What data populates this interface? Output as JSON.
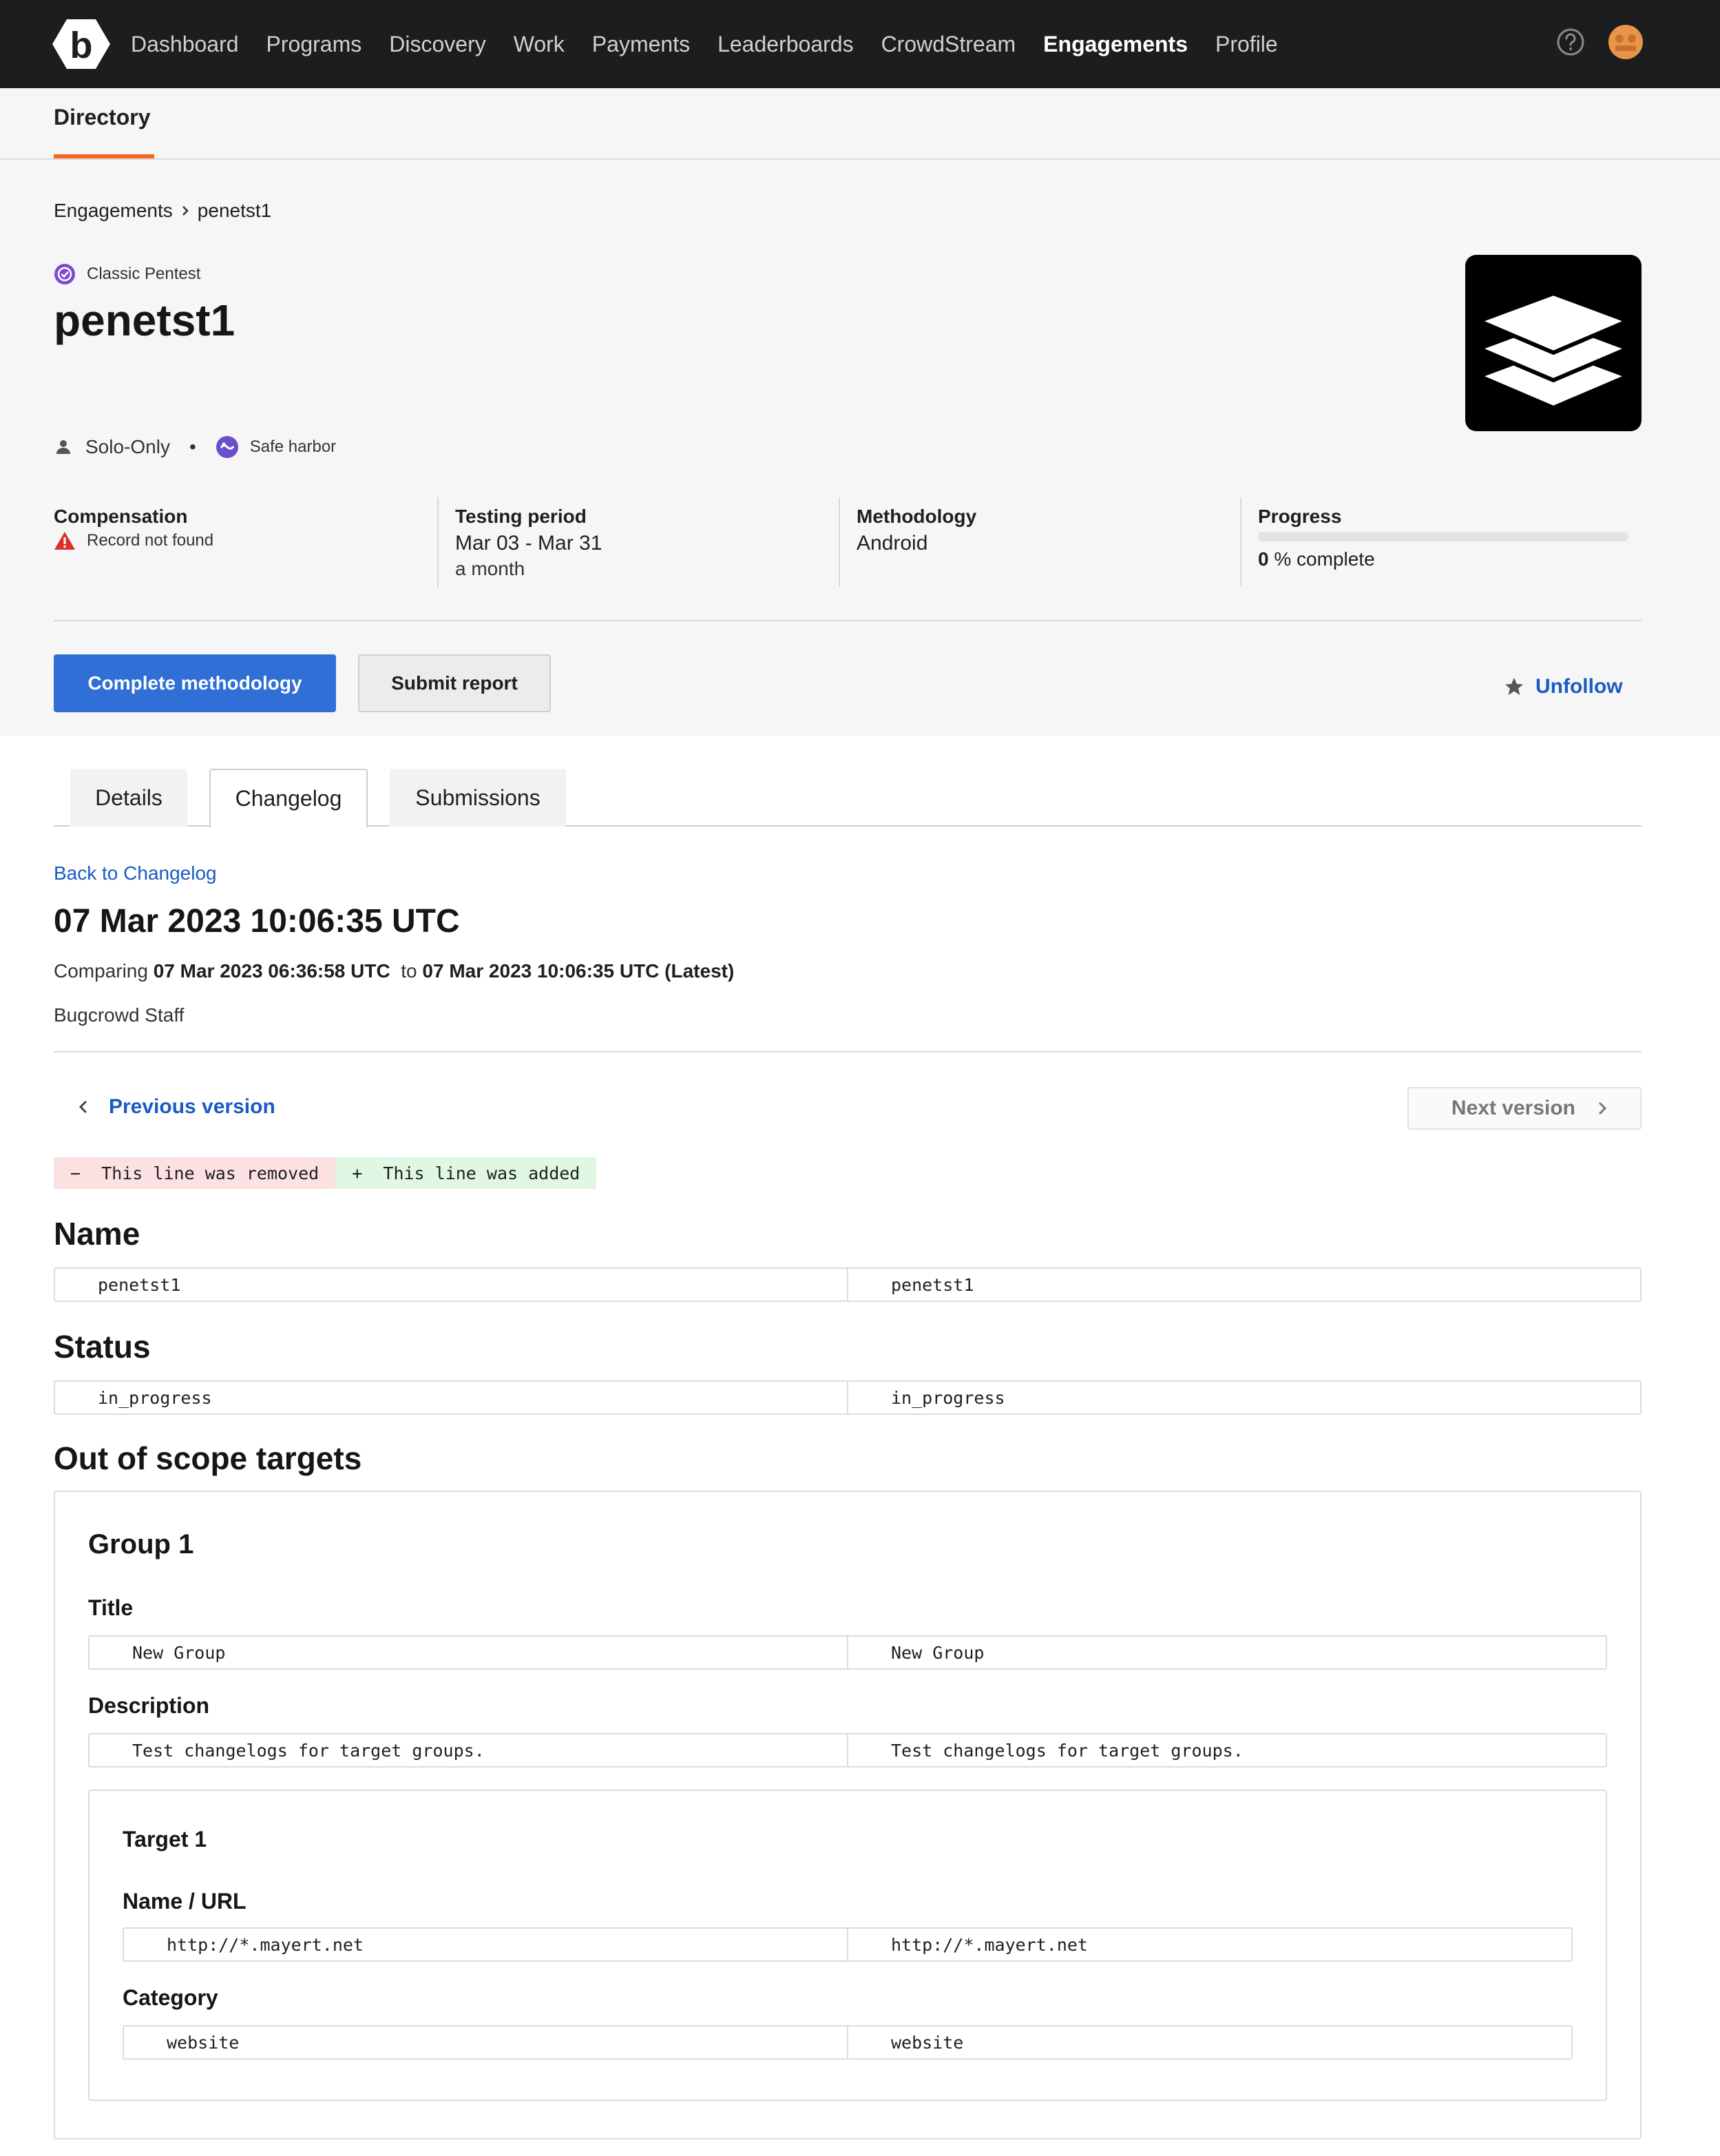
{
  "nav": {
    "items": [
      {
        "label": "Dashboard",
        "active": false
      },
      {
        "label": "Programs",
        "active": false
      },
      {
        "label": "Discovery",
        "active": false
      },
      {
        "label": "Work",
        "active": false
      },
      {
        "label": "Payments",
        "active": false
      },
      {
        "label": "Leaderboards",
        "active": false
      },
      {
        "label": "CrowdStream",
        "active": false
      },
      {
        "label": "Engagements",
        "active": true
      },
      {
        "label": "Profile",
        "active": false
      }
    ]
  },
  "subheader": {
    "tab": "Directory"
  },
  "breadcrumb": {
    "parent": "Engagements",
    "current": "penetst1"
  },
  "engagement": {
    "type": "Classic Pentest",
    "title": "penetst1",
    "mode": "Solo-Only",
    "safe_harbor": "Safe harbor"
  },
  "stats": {
    "compensation": {
      "label": "Compensation",
      "value": "Record not found"
    },
    "testing_period": {
      "label": "Testing period",
      "value": "Mar 03 - Mar 31",
      "sub": "a month"
    },
    "methodology": {
      "label": "Methodology",
      "value": "Android"
    },
    "progress": {
      "label": "Progress",
      "percent": "0",
      "suffix": " % complete"
    }
  },
  "actions": {
    "complete": "Complete methodology",
    "submit": "Submit report",
    "unfollow": "Unfollow"
  },
  "tabs": {
    "details": "Details",
    "changelog": "Changelog",
    "submissions": "Submissions"
  },
  "changelog": {
    "back": "Back to Changelog",
    "title": "07 Mar 2023 10:06:35 UTC",
    "comparing_prefix": "Comparing ",
    "from": "07 Mar 2023 06:36:58 UTC",
    "to_word": "  to ",
    "to": "07 Mar 2023 10:06:35 UTC (Latest)",
    "author": "Bugcrowd Staff",
    "prev": "Previous version",
    "next": "Next version",
    "legend_removed": "−  This line was removed",
    "legend_added": "+  This line was added"
  },
  "diff": {
    "name": {
      "heading": "Name",
      "old": "penetst1",
      "new": "penetst1"
    },
    "status": {
      "heading": "Status",
      "old": "in_progress",
      "new": "in_progress"
    },
    "out_of_scope": {
      "heading": "Out of scope targets",
      "group": {
        "heading": "Group 1",
        "title": {
          "label": "Title",
          "old": "New Group",
          "new": "New Group"
        },
        "description": {
          "label": "Description",
          "old": "Test changelogs for target groups.",
          "new": "Test changelogs for target groups."
        },
        "target": {
          "heading": "Target 1",
          "name_url": {
            "label": "Name / URL",
            "old": "http://*.mayert.net",
            "new": "http://*.mayert.net"
          },
          "category": {
            "label": "Category",
            "old": "website",
            "new": "website"
          }
        }
      }
    }
  },
  "colors": {
    "accent": "#f26822",
    "primary": "#2f6fd6",
    "link": "#1a5bc4",
    "nav_bg": "#1c1d1f"
  }
}
